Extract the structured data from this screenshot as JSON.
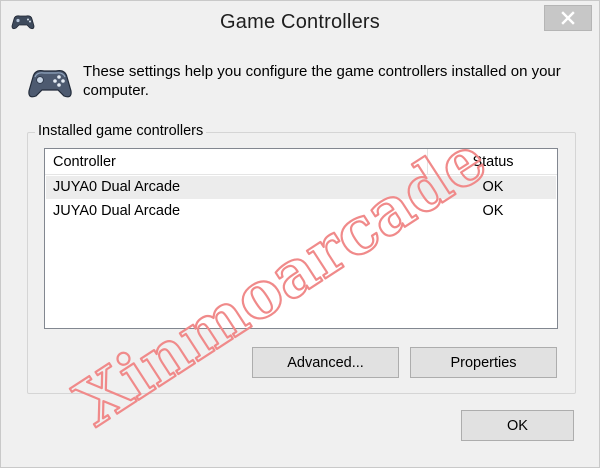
{
  "window": {
    "title": "Game Controllers",
    "title_icon": "gamepad-icon",
    "close_icon": "close-icon"
  },
  "header": {
    "icon": "gamepad-icon",
    "description": "These settings help you configure the game controllers installed on your computer."
  },
  "group": {
    "label": "Installed game controllers"
  },
  "list": {
    "columns": [
      "Controller",
      "Status"
    ],
    "rows": [
      {
        "controller": "JUYA0 Dual Arcade",
        "status": "OK"
      },
      {
        "controller": "JUYA0 Dual Arcade",
        "status": "OK"
      }
    ]
  },
  "buttons": {
    "advanced": "Advanced...",
    "properties": "Properties",
    "ok": "OK"
  },
  "watermark": {
    "text": "Xinmoarcade",
    "color": "#f08a8a"
  },
  "colors": {
    "background": "#f0f0f0",
    "button_face": "#e1e1e1",
    "close_button": "#c7c7c7",
    "selected_row": "#ececec"
  }
}
